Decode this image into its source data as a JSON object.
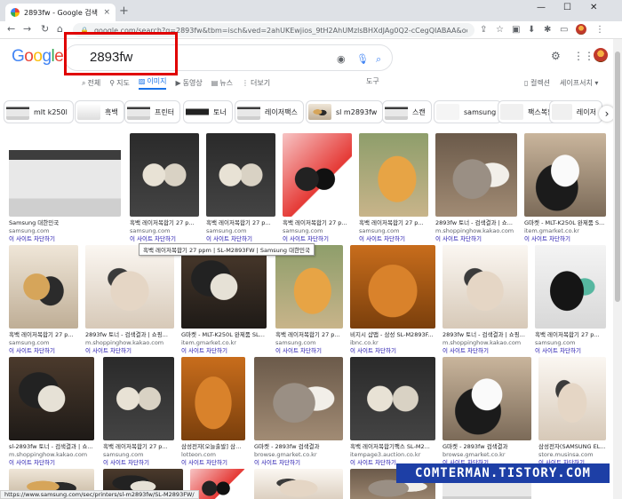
{
  "browser": {
    "tab_title": "2893fw - Google 검색",
    "url": "google.com/search?q=2893fw&tbm=isch&ved=2ahUKEwjios_9tH2AhUMzlsBHXdJAg0Q2-cCegQIABAA&oq=2893fw&gs_lcp=Cg...",
    "new_tab": "+",
    "close_tab": "×",
    "minimize": "—",
    "maximize": "☐",
    "close_window": "✕"
  },
  "google": {
    "logo": [
      "G",
      "o",
      "o",
      "g",
      "l",
      "e"
    ],
    "logo_colors": [
      "#4285f4",
      "#ea4335",
      "#fbbc05",
      "#4285f4",
      "#34a853",
      "#ea4335"
    ],
    "query": "2893fw",
    "tabs": [
      {
        "label": "전체",
        "icon": "search-icon"
      },
      {
        "label": "지도",
        "icon": "map-pin-icon"
      },
      {
        "label": "이미지",
        "icon": "image-icon",
        "active": true
      },
      {
        "label": "동영상",
        "icon": "video-icon"
      },
      {
        "label": "뉴스",
        "icon": "news-icon"
      },
      {
        "label": "더보기",
        "icon": "more-icon"
      }
    ],
    "tools": "도구",
    "collections": "컬렉션",
    "safesearch": "세이프서치"
  },
  "chips": [
    {
      "label": "mlt k250l"
    },
    {
      "label": "흑백"
    },
    {
      "label": "프린터"
    },
    {
      "label": "토너"
    },
    {
      "label": "레이저팩스"
    },
    {
      "label": "sl m2893fw"
    },
    {
      "label": "스캔"
    },
    {
      "label": "samsung"
    },
    {
      "label": "팩스복합기"
    },
    {
      "label": "레이저"
    }
  ],
  "results": [
    {
      "caption": "Samsung 대한민국",
      "source": "samsung.com",
      "license": "이 사이트 차단하기"
    },
    {
      "caption": "흑백 레이저복합기 27 p...",
      "source": "samsung.com",
      "license": "이 사이트 차단하기"
    },
    {
      "caption": "흑백 레이저복합기 27 p...",
      "source": "samsung.com",
      "license": "이 사이트 차단하기"
    },
    {
      "caption": "흑백 레이저복합기 27 p...",
      "source": "samsung.com",
      "license": "이 사이트 차단하기"
    },
    {
      "caption": "흑백 레이저복합기 27 p...",
      "source": "samsung.com",
      "license": "이 사이트 차단하기"
    },
    {
      "caption": "2893fw 토너 - 검색결과 | 쇼...",
      "source": "m.shoppinghow.kakao.com",
      "license": "이 사이트 차단하기"
    },
    {
      "caption": "G마켓 - MLT-K250L 완제품 S...",
      "source": "item.gmarket.co.kr",
      "license": "이 사이트 차단하기"
    },
    {
      "caption": "흑백 레이저복합기 27 p...",
      "source": "samsung.com",
      "license": "이 사이트 차단하기"
    },
    {
      "caption": "2893fw 토너 - 검색결과 | 쇼핑...",
      "source": "m.shoppinghow.kakao.com",
      "license": "이 사이트 차단하기"
    },
    {
      "caption": "G마켓 - MLT-K250L 완제품 SL-...",
      "source": "item.gmarket.co.kr",
      "license": "이 사이트 차단하기"
    },
    {
      "caption": "흑백 레이저복합기 27 p...",
      "source": "samsung.com",
      "license": "이 사이트 차단하기"
    },
    {
      "caption": "비지시 샵맵 - 삼성 SL-M2893F...",
      "source": "ibnc.co.kr",
      "license": "이 사이트 차단하기"
    },
    {
      "caption": "2893fw 토너 - 검색결과 | 쇼핑...",
      "source": "m.shoppinghow.kakao.com",
      "license": "이 사이트 차단하기"
    },
    {
      "caption": "흑백 레이저복합기 27 p...",
      "source": "samsung.com",
      "license": "이 사이트 차단하기"
    },
    {
      "caption": "sl-2893fw 토너 - 검색결과 | 쇼핑하우",
      "source": "m.shoppinghow.kakao.com",
      "license": "이 사이트 차단하기"
    },
    {
      "caption": "흑백 레이저복합기 27 p...",
      "source": "samsung.com",
      "license": "이 사이트 차단하기"
    },
    {
      "caption": "삼성전자[오늘출발] 삼성...",
      "source": "lotteon.com",
      "license": "이 사이트 차단하기"
    },
    {
      "caption": "G마켓 - 2893fw 검색결과",
      "source": "browse.gmarket.co.kr",
      "license": "이 사이트 차단하기"
    },
    {
      "caption": "흑백 레이저복합기팩스 SL-M2...",
      "source": "itempage3.auction.co.kr",
      "license": "이 사이트 차단하기"
    },
    {
      "caption": "G마켓 - 2893fw 검색결과",
      "source": "browse.gmarket.co.kr",
      "license": "이 사이트 차단하기"
    },
    {
      "caption": "삼성전자(SAMSUNG EL...",
      "source": "store.musinsa.com",
      "license": "이 사이트 차단하기"
    }
  ],
  "tooltip": "흑백 레이저복합기 27 ppm | SL-M2893FW | Samsung 대한민국",
  "status_url": "https://www.samsung.com/sec/printers/sl-m2893fw/SL-M2893FW/",
  "watermark": "COMTERMAN.TISTORY.COM"
}
